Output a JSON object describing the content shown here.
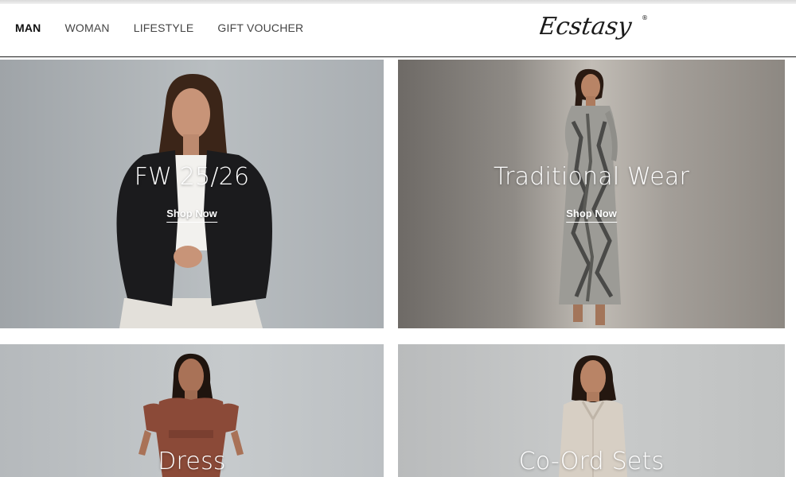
{
  "nav": {
    "items": [
      {
        "label": "MAN",
        "active": true
      },
      {
        "label": "WOMAN",
        "active": false
      },
      {
        "label": "LIFESTYLE",
        "active": false
      },
      {
        "label": "GIFT VOUCHER",
        "active": false
      }
    ]
  },
  "brand": {
    "logo_text": "Ecstasy",
    "registered_mark": "®"
  },
  "tiles": [
    {
      "caption": "FW 25/26",
      "cta": "Shop Now"
    },
    {
      "caption": "Traditional Wear",
      "cta": "Shop Now"
    },
    {
      "caption": "Dress"
    },
    {
      "caption": "Co-Ord Sets"
    }
  ],
  "colors": {
    "text_dark": "#111111",
    "nav_text": "#444444",
    "overlay_text": "#ffffff",
    "header_rule": "#1a1a1a"
  }
}
